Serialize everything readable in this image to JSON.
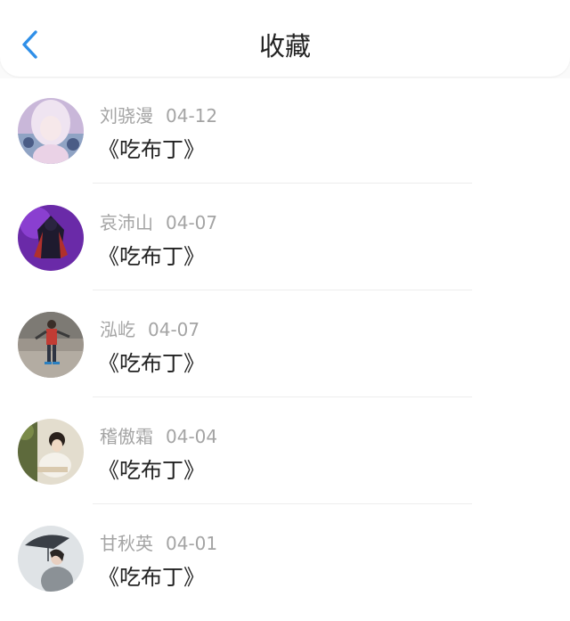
{
  "header": {
    "title": "收藏",
    "back_icon": "chevron-left-icon",
    "accent_color": "#2f8fe8"
  },
  "favorites": [
    {
      "user": "刘骁漫",
      "date": "04-12",
      "title": "《吃布丁》"
    },
    {
      "user": "哀沛山",
      "date": "04-07",
      "title": "《吃布丁》"
    },
    {
      "user": "泓屹",
      "date": "04-07",
      "title": "《吃布丁》"
    },
    {
      "user": "稽傲霜",
      "date": "04-04",
      "title": "《吃布丁》"
    },
    {
      "user": "甘秋英",
      "date": "04-01",
      "title": "《吃布丁》"
    }
  ]
}
